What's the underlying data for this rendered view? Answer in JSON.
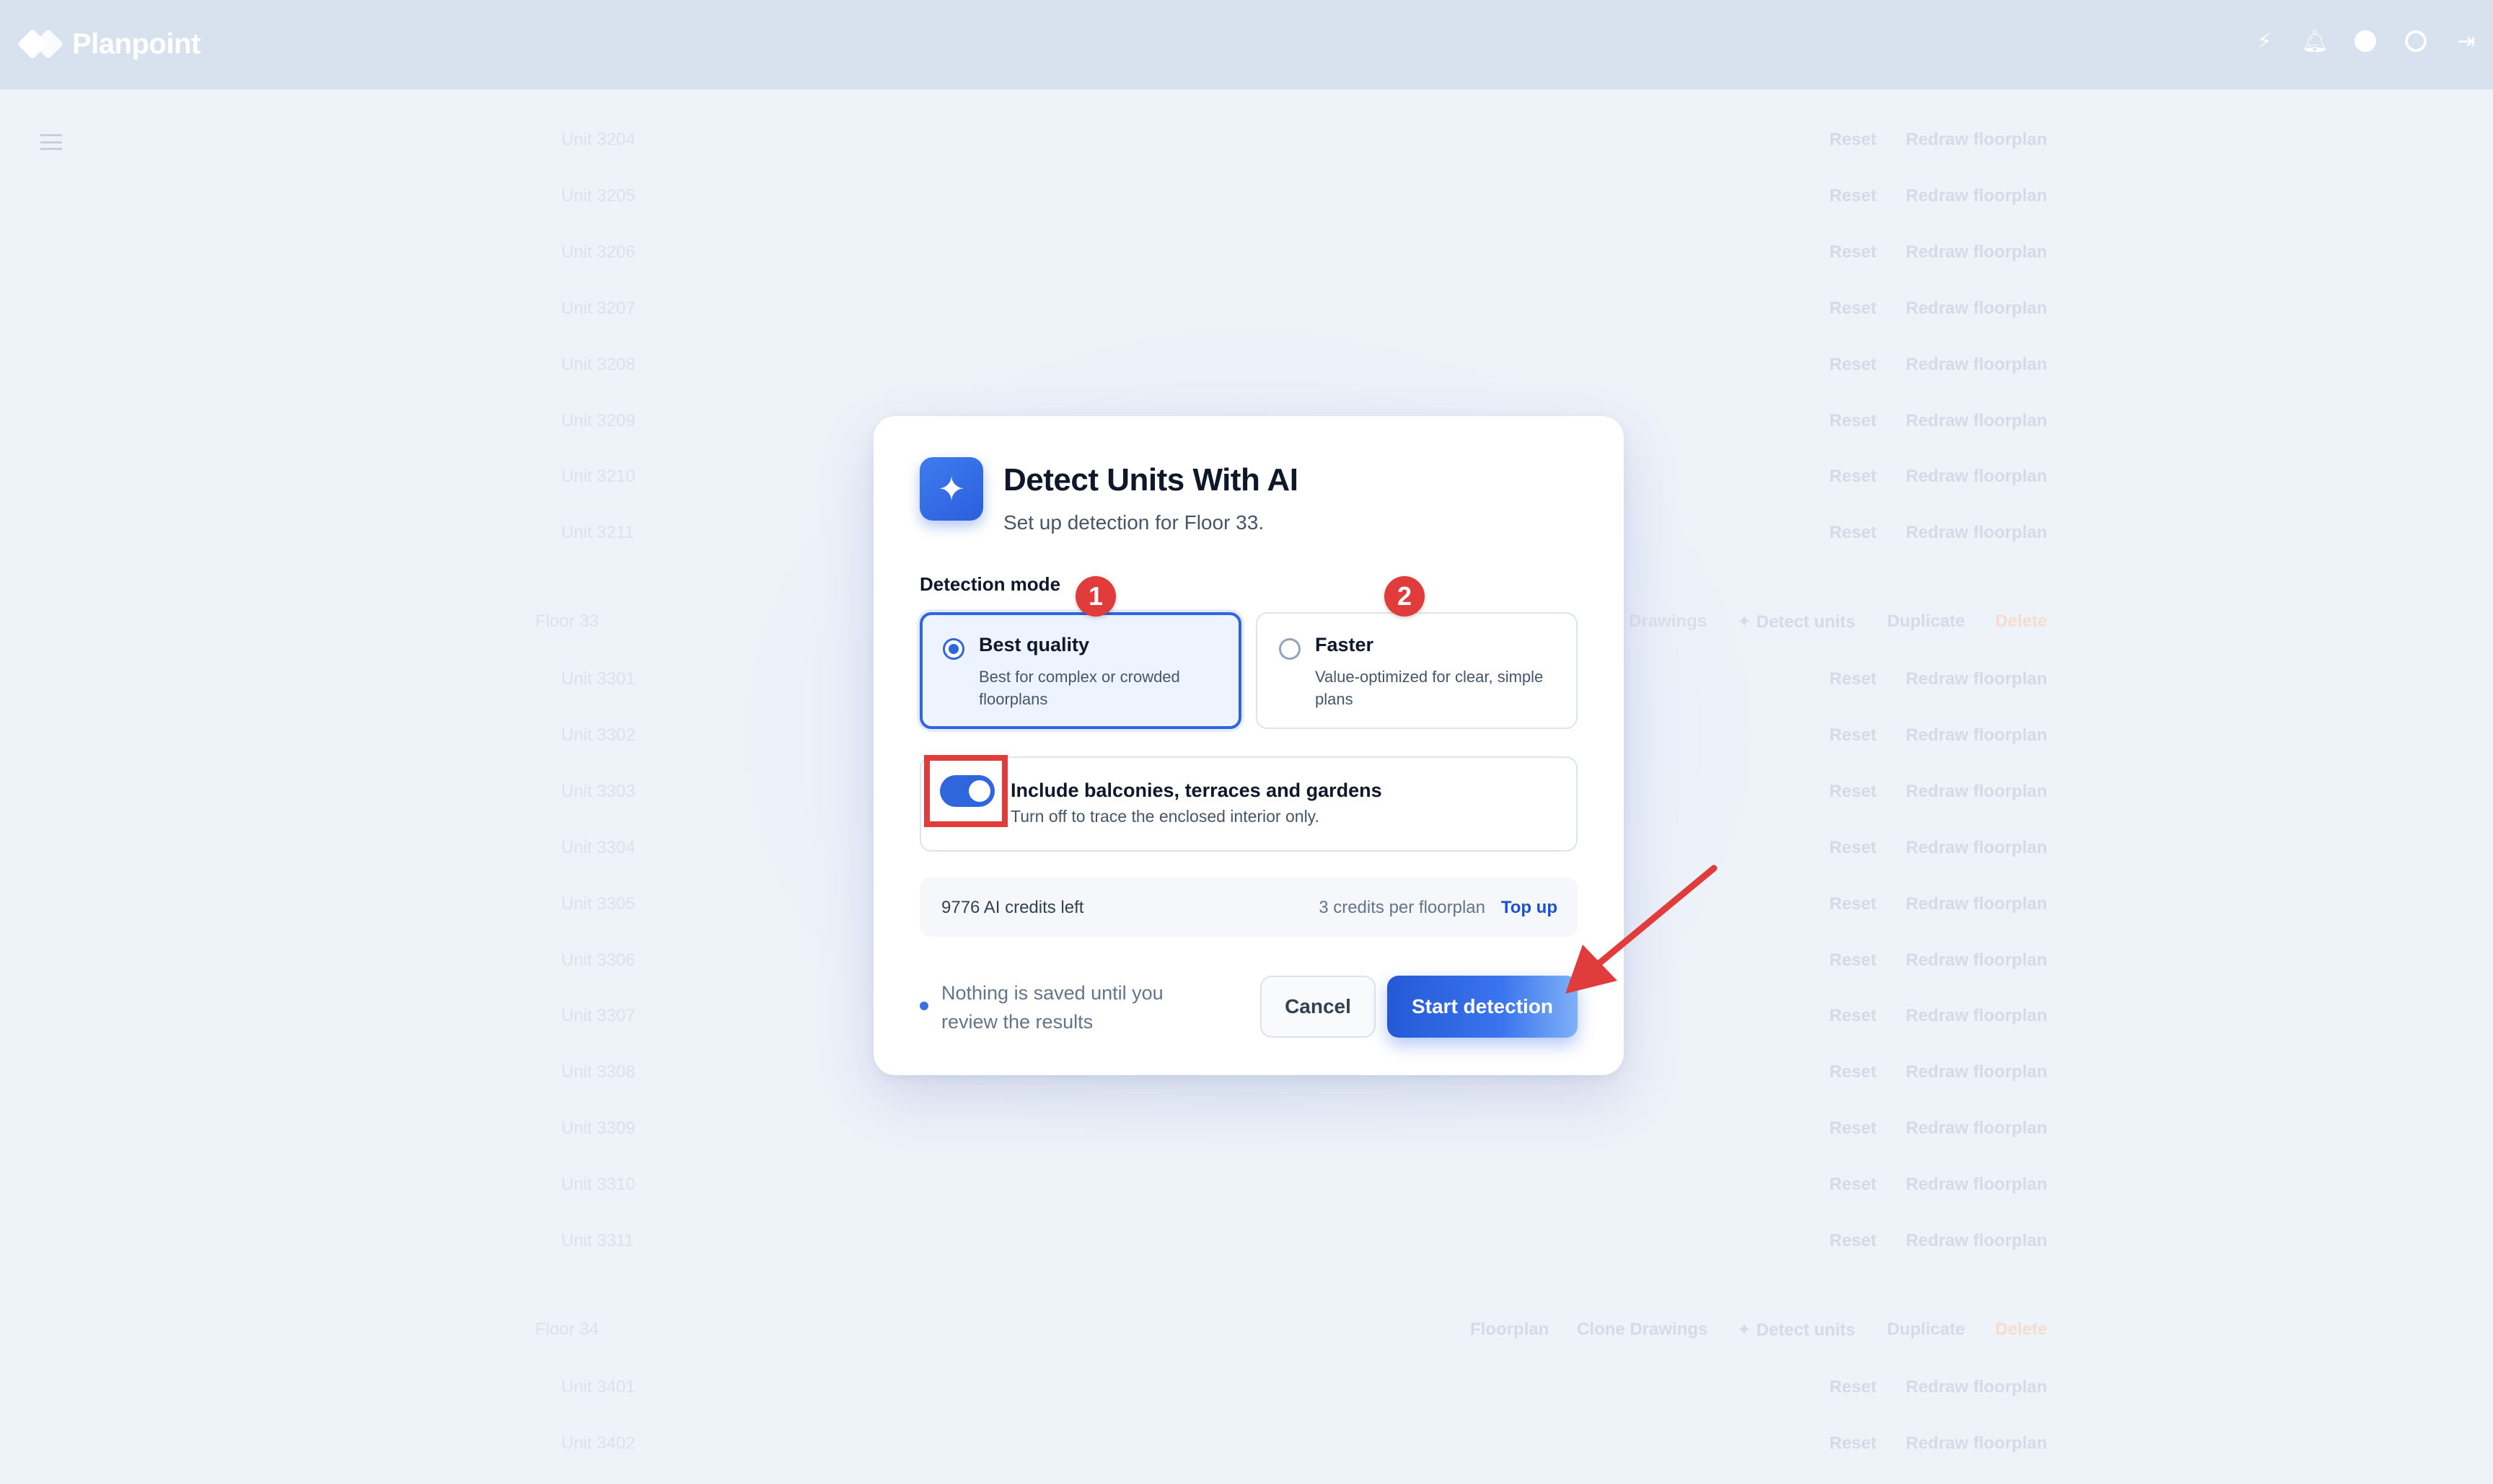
{
  "app": {
    "name": "Planpoint"
  },
  "topbar": {
    "icons": [
      "bolt-icon",
      "bell-icon",
      "help-icon",
      "settings-icon",
      "logout-icon"
    ]
  },
  "background": {
    "floor33_units_top": [
      "Unit 3204",
      "Unit 3205",
      "Unit 3206",
      "Unit 3207",
      "Unit 3208",
      "Unit 3209",
      "Unit 3210",
      "Unit 3211"
    ],
    "floor33_label": "Floor 33",
    "floor33_units": [
      "Unit 3301",
      "Unit 3302",
      "Unit 3303",
      "Unit 3304",
      "Unit 3305",
      "Unit 3306",
      "Unit 3307",
      "Unit 3308",
      "Unit 3309",
      "Unit 3310",
      "Unit 3311"
    ],
    "floor34_label": "Floor 34",
    "floor34_units": [
      "Unit 3401",
      "Unit 3402"
    ],
    "row_actions": {
      "reset": "Reset",
      "redraw": "Redraw floorplan"
    },
    "floor_actions": {
      "floorplan": "Floorplan",
      "clone": "Clone Drawings",
      "detect": "Detect units",
      "duplicate": "Duplicate",
      "delete": "Delete"
    }
  },
  "modal": {
    "title": "Detect Units With AI",
    "subtitle": "Set up detection for Floor 33.",
    "section_label": "Detection mode",
    "modes": [
      {
        "title": "Best quality",
        "desc": "Best for complex or crowded floorplans",
        "selected": true
      },
      {
        "title": "Faster",
        "desc": "Value-optimized for clear, simple plans",
        "selected": false
      }
    ],
    "toggle": {
      "title": "Include balconies, terraces and gardens",
      "desc": "Turn off to trace the enclosed interior only.",
      "on": true
    },
    "credits": {
      "left": "9776 AI credits left",
      "per": "3 credits per floorplan",
      "top_up": "Top up"
    },
    "note": "Nothing is saved until you review the results",
    "cancel": "Cancel",
    "start": "Start detection"
  },
  "annotations": {
    "badge1": "1",
    "badge2": "2",
    "highlight_color": "#e03c3c"
  },
  "colors": {
    "accent": "#2f66dd",
    "annotation": "#e03c3c"
  }
}
